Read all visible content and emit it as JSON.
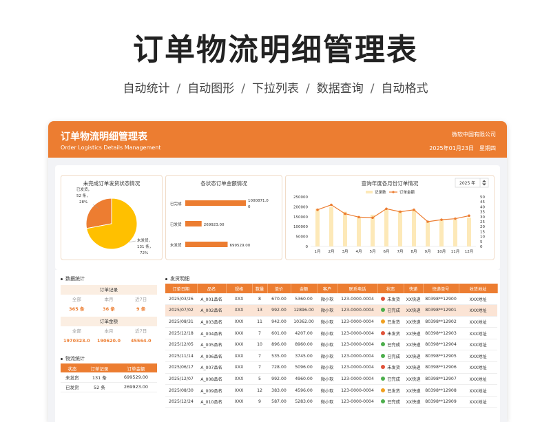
{
  "hero": {
    "title": "订单物流明细管理表",
    "features": [
      "自动统计",
      "自动图形",
      "下拉列表",
      "数据查询",
      "自动格式"
    ],
    "separator": "/"
  },
  "header": {
    "title": "订单物流明细管理表",
    "subtitle": "Order Logistics Details Management",
    "company": "微软中国有限公司",
    "date": "2025年01月23日",
    "weekday": "星期四"
  },
  "colors": {
    "accent": "#ec7d31",
    "bar_light": "#fde9b8",
    "pie_yellow": "#ffc000",
    "pie_orange": "#ed7d31"
  },
  "pie": {
    "title": "未完成订单发货状态情况",
    "slices": [
      {
        "label": "已发货",
        "count": "52 条",
        "pct": "28%",
        "value": 28
      },
      {
        "label": "未发货",
        "count": "131 条",
        "pct": "72%",
        "value": 72
      }
    ]
  },
  "amount_bars": {
    "title": "各状态订单金额情况",
    "items": [
      {
        "label": "已完成",
        "value_text": "1000871.0",
        "value_text2": "0",
        "value": 1000871.0
      },
      {
        "label": "已发货",
        "value_text": "269923.00",
        "value": 269923.0
      },
      {
        "label": "未发货",
        "value_text": "699529.00",
        "value": 699529.0
      }
    ]
  },
  "monthly": {
    "title": "查询年度各月份订单情况",
    "year_select": "2025 年",
    "legend_bar": "记录数",
    "legend_line": "订单金额"
  },
  "chart_data": {
    "type": "bar",
    "title": "查询年度各月份订单情况",
    "categories": [
      "1月",
      "2月",
      "3月",
      "4月",
      "5月",
      "6月",
      "7月",
      "8月",
      "9月",
      "10月",
      "11月",
      "12月"
    ],
    "series": [
      {
        "name": "记录数",
        "type": "bar",
        "axis": "right",
        "values": [
          38,
          40,
          35,
          29,
          32,
          37,
          36,
          37,
          25,
          27,
          27,
          29
        ]
      },
      {
        "name": "订单金额",
        "type": "line",
        "axis": "left",
        "values": [
          185000,
          210000,
          165000,
          148000,
          145000,
          190000,
          175000,
          185000,
          125000,
          135000,
          140000,
          155000
        ]
      }
    ],
    "left_ticks": [
      "0",
      "50000",
      "100000",
      "150000",
      "200000",
      "250000"
    ],
    "right_ticks": [
      "0",
      "5",
      "10",
      "15",
      "20",
      "25",
      "30",
      "35",
      "40",
      "45",
      "50"
    ],
    "ylim_left": [
      0,
      250000
    ],
    "ylim_right": [
      0,
      50
    ],
    "legend": "top"
  },
  "data_stats": {
    "title": "数据统计",
    "order_records": {
      "title": "订单记录",
      "labels": [
        "全部",
        "本月",
        "近7日"
      ],
      "values": [
        "365 条",
        "36 条",
        "9 条"
      ]
    },
    "order_amount": {
      "title": "订单金额",
      "labels": [
        "全部",
        "本月",
        "近7日"
      ],
      "values": [
        "1970323.0",
        "190620.0",
        "45564.0"
      ]
    }
  },
  "logistics": {
    "title": "物流统计",
    "headers": [
      "状态",
      "订单记录",
      "订单金额"
    ],
    "rows": [
      [
        "未发货",
        "131 条",
        "699529.00"
      ],
      [
        "已发货",
        "52 条",
        "269923.00"
      ]
    ]
  },
  "details": {
    "title": "发货明细",
    "headers": [
      "订单日期",
      "品名",
      "规格",
      "数量",
      "单价",
      "金额",
      "客户",
      "联系电话",
      "状态",
      "快递",
      "快递单号",
      "收货地址"
    ],
    "rows": [
      {
        "cells": [
          "2025/03/26",
          "A_001品名",
          "XXX",
          "8",
          "670.00",
          "5360.00",
          "微小软",
          "123-0000-0004"
        ],
        "status": "未发货",
        "status_color": "red",
        "rest": [
          "XX快递",
          "80398**12900",
          "XXX地址"
        ]
      },
      {
        "cells": [
          "2025/07/02",
          "A_002品名",
          "XXX",
          "13",
          "992.00",
          "12896.00",
          "微小软",
          "123-0000-0004"
        ],
        "status": "已完成",
        "status_color": "green",
        "rest": [
          "XX快递",
          "80398**12901",
          "XXX地址"
        ]
      },
      {
        "cells": [
          "2025/08/31",
          "A_003品名",
          "XXX",
          "11",
          "942.00",
          "10362.00",
          "微小软",
          "123-0000-0004"
        ],
        "status": "已发货",
        "status_color": "orange",
        "rest": [
          "XX快递",
          "80398**12902",
          "XXX地址"
        ]
      },
      {
        "cells": [
          "2025/12/18",
          "A_004品名",
          "XXX",
          "7",
          "601.00",
          "4207.00",
          "微小软",
          "123-0000-0004"
        ],
        "status": "未发货",
        "status_color": "red",
        "rest": [
          "XX快递",
          "80398**12903",
          "XXX地址"
        ]
      },
      {
        "cells": [
          "2025/12/05",
          "A_005品名",
          "XXX",
          "10",
          "896.00",
          "8960.00",
          "微小软",
          "123-0000-0004"
        ],
        "status": "已完成",
        "status_color": "green",
        "rest": [
          "XX快递",
          "80398**12904",
          "XXX地址"
        ]
      },
      {
        "cells": [
          "2025/11/14",
          "A_006品名",
          "XXX",
          "7",
          "535.00",
          "3745.00",
          "微小软",
          "123-0000-0004"
        ],
        "status": "已完成",
        "status_color": "green",
        "rest": [
          "XX快递",
          "80398**12905",
          "XXX地址"
        ]
      },
      {
        "cells": [
          "2025/06/17",
          "A_007品名",
          "XXX",
          "7",
          "728.00",
          "5096.00",
          "微小软",
          "123-0000-0004"
        ],
        "status": "未发货",
        "status_color": "red",
        "rest": [
          "XX快递",
          "80398**12906",
          "XXX地址"
        ]
      },
      {
        "cells": [
          "2025/12/07",
          "A_008品名",
          "XXX",
          "5",
          "992.00",
          "4960.00",
          "微小软",
          "123-0000-0004"
        ],
        "status": "已完成",
        "status_color": "green",
        "rest": [
          "XX快递",
          "80398**12907",
          "XXX地址"
        ]
      },
      {
        "cells": [
          "2025/08/30",
          "A_009品名",
          "XXX",
          "12",
          "383.00",
          "4596.00",
          "微小软",
          "123-0000-0004"
        ],
        "status": "已发货",
        "status_color": "orange",
        "rest": [
          "XX快递",
          "80398**12908",
          "XXX地址"
        ]
      },
      {
        "cells": [
          "2025/12/24",
          "A_010品名",
          "XXX",
          "9",
          "587.00",
          "5283.00",
          "微小软",
          "123-0000-0004"
        ],
        "status": "已完成",
        "status_color": "green",
        "rest": [
          "XX快递",
          "80398**12909",
          "XXX地址"
        ]
      }
    ]
  }
}
